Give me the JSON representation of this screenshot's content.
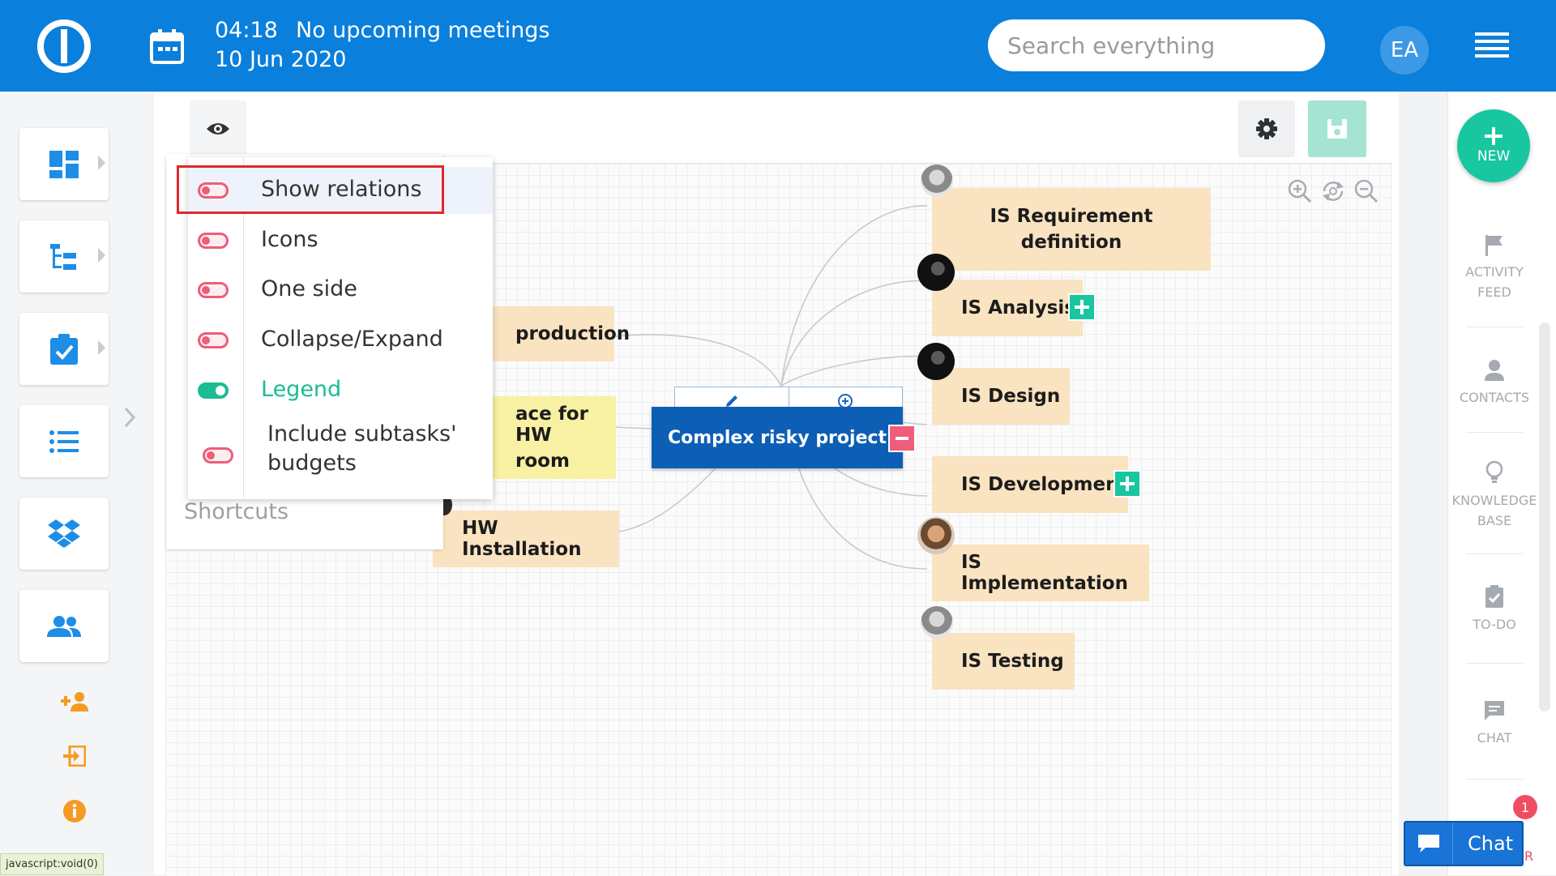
{
  "header": {
    "time": "04:18",
    "meetings": "No upcoming meetings",
    "date": "10 Jun 2020",
    "search_placeholder": "Search everything",
    "avatar_initials": "EA",
    "brand_color": "#0a7fdc"
  },
  "mindmap": {
    "center_node": "Complex risky project",
    "left_nodes": [
      "production",
      "ace for HW",
      "room",
      "HW Installation"
    ],
    "right_nodes": [
      "IS Requirement",
      "definition",
      "IS Analysis",
      "IS Design",
      "IS Development",
      "IS Implementation",
      "IS Testing"
    ]
  },
  "view_menu": {
    "items": [
      {
        "label": "Show relations",
        "enabled": false
      },
      {
        "label": "Icons",
        "enabled": false
      },
      {
        "label": "One side",
        "enabled": false
      },
      {
        "label": "Collapse/Expand",
        "enabled": false
      },
      {
        "label": "Legend",
        "enabled": true
      },
      {
        "label": "Include subtasks'",
        "enabled": false
      },
      {
        "label": "budgets",
        "enabled": false
      }
    ],
    "shortcuts_label": "Shortcuts"
  },
  "right_sidebar": {
    "new_label": "NEW",
    "activity_feed": [
      "ACTIVITY",
      "FEED"
    ],
    "contacts": "CONTACTS",
    "knowledge_base": [
      "KNOWLEDGE",
      "BASE"
    ],
    "todo": "TO-DO",
    "chat": "CHAT",
    "notification_count": "1",
    "partial_label": "R"
  },
  "chat_button": {
    "label": "Chat"
  },
  "status_bar": {
    "text": "javascript:void(0)"
  },
  "colors": {
    "accent_green": "#18c6a0",
    "toggle_off": "#ee5d79",
    "node_fill": "#fae3c0",
    "center_node": "#0d5fb5"
  }
}
